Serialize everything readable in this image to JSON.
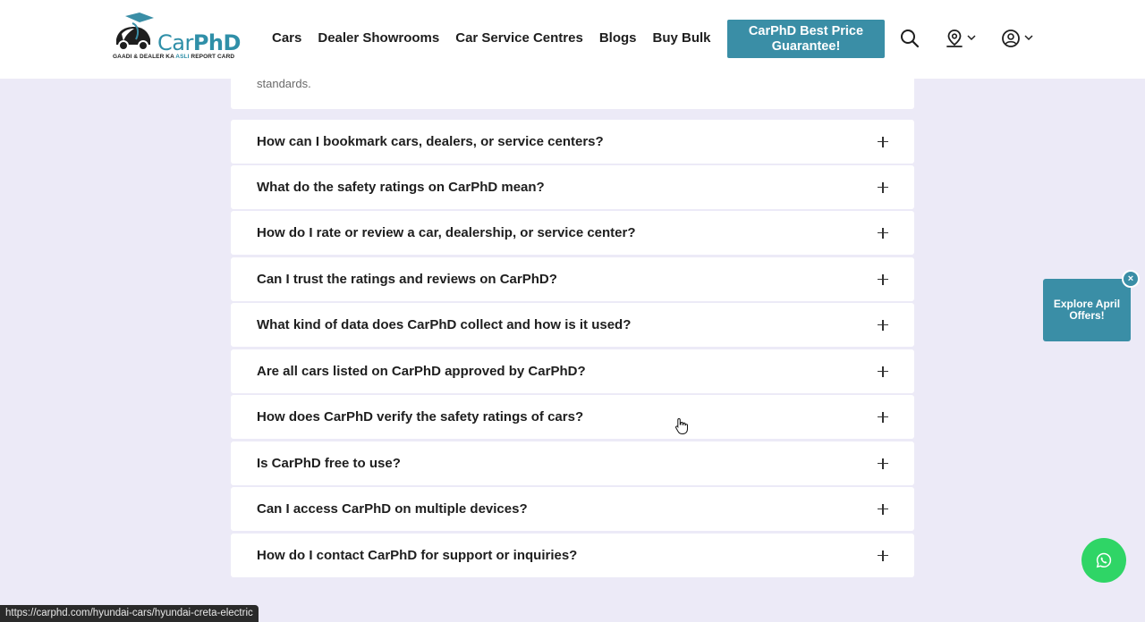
{
  "header": {
    "logo": {
      "name_prefix": "Car",
      "name_suffix": "PhD",
      "tagline_prefix": "GAADI & DEALER KA ",
      "tagline_highlight": "ASLI",
      "tagline_suffix": " REPORT CARD"
    },
    "nav": [
      "Cars",
      "Dealer Showrooms",
      "Car Service Centres",
      "Blogs",
      "Buy Bulk"
    ],
    "cta_label": "CarPhD Best Price Guarantee!",
    "icons": [
      "search-icon",
      "location-icon",
      "user-icon"
    ]
  },
  "faq": {
    "previous_answer_tail": "standards.",
    "items": [
      "How can I bookmark cars, dealers, or service centers?",
      "What do the safety ratings on CarPhD mean?",
      "How do I rate or review a car, dealership, or service center?",
      "Can I trust the ratings and reviews on CarPhD?",
      "What kind of data does CarPhD collect and how is it used?",
      "Are all cars listed on CarPhD approved by CarPhD?",
      "How does CarPhD verify the safety ratings of cars?",
      "Is CarPhD free to use?",
      "Can I access CarPhD on multiple devices?",
      "How do I contact CarPhD for support or inquiries?"
    ]
  },
  "offer": {
    "label": "Explore April Offers!",
    "close": "×"
  },
  "status_url": "https://carphd.com/hyundai-cars/hyundai-creta-electric",
  "colors": {
    "accent": "#3a8ea6",
    "whatsapp": "#2fd566",
    "background": "#eceaf7"
  }
}
